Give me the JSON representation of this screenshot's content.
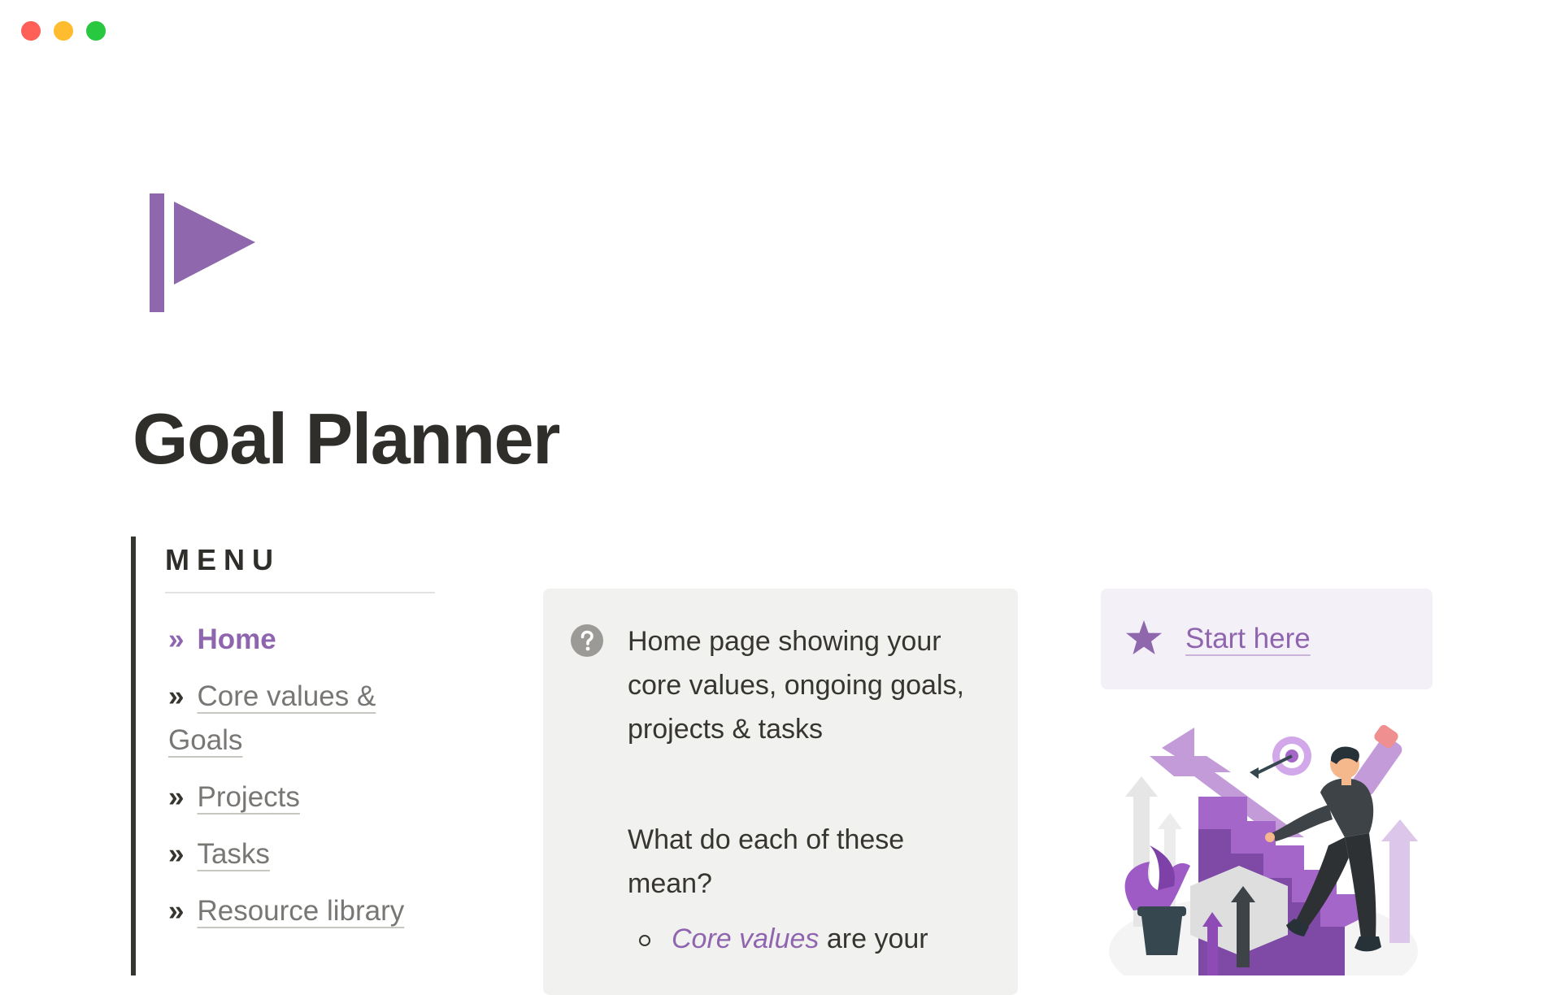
{
  "page": {
    "title": "Goal Planner",
    "icon": "flag-play-icon"
  },
  "menu": {
    "heading": "MENU",
    "items": [
      {
        "label": "Home",
        "active": true
      },
      {
        "label": "Core values & Goals",
        "active": false
      },
      {
        "label": "Projects",
        "active": false
      },
      {
        "label": "Tasks",
        "active": false
      },
      {
        "label": "Resource library",
        "active": false
      }
    ],
    "arrow_glyph": "»"
  },
  "callout": {
    "icon": "question-circle-icon",
    "intro": "Home page showing your core values, ongoing goals, projects & tasks",
    "question": "What do each of these mean?",
    "bullet_term": "Core values",
    "bullet_text": " are your"
  },
  "start_box": {
    "icon": "star-icon",
    "link_label": "Start here"
  },
  "illustration": {
    "icon": "person-climbing-stairs-illustration"
  },
  "colors": {
    "accent": "#9065b0",
    "text": "#37352f",
    "muted": "#787774",
    "callout_bg": "#f1f1ef",
    "start_bg": "#f4f0f7"
  }
}
